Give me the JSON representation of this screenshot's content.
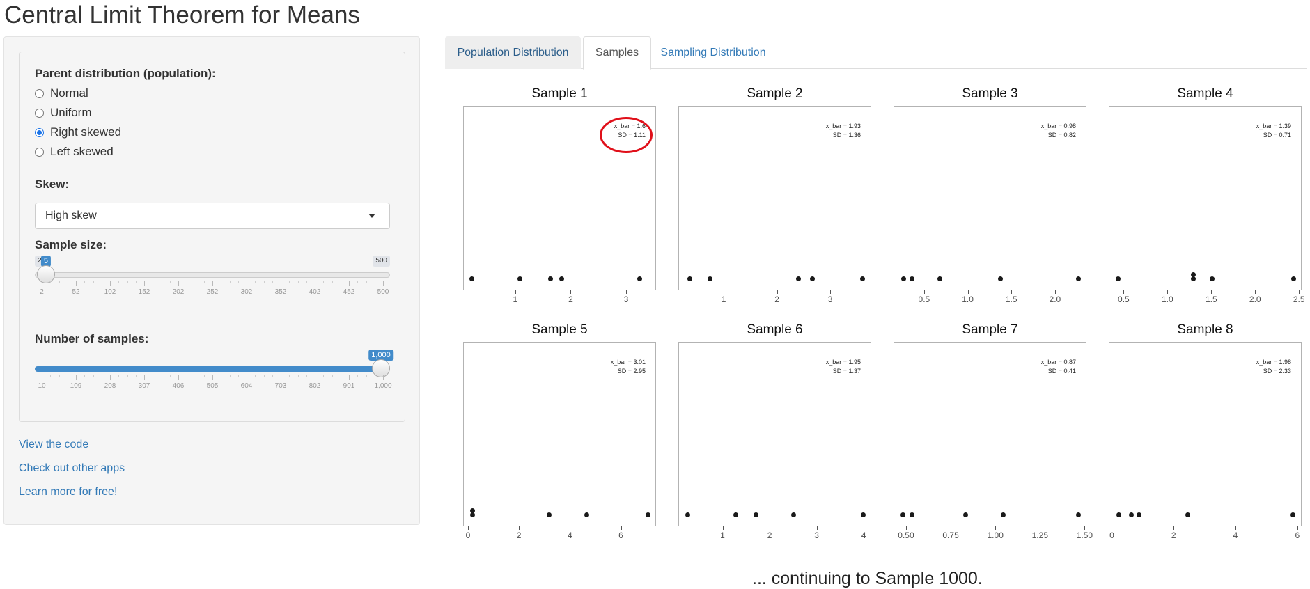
{
  "app": {
    "title": "Central Limit Theorem for Means"
  },
  "sidebar": {
    "parent_label": "Parent distribution (population):",
    "parent_options": [
      {
        "label": "Normal",
        "checked": false
      },
      {
        "label": "Uniform",
        "checked": false
      },
      {
        "label": "Right skewed",
        "checked": true
      },
      {
        "label": "Left skewed",
        "checked": false
      }
    ],
    "skew_label": "Skew:",
    "skew_value": "High skew",
    "sample_size": {
      "label": "Sample size:",
      "min": 2,
      "max": 500,
      "value": 5,
      "min_text": "2",
      "max_text": "500",
      "value_text": "5",
      "grid": [
        "2",
        "52",
        "102",
        "152",
        "202",
        "252",
        "302",
        "352",
        "402",
        "452",
        "500"
      ]
    },
    "num_samples": {
      "label": "Number of samples:",
      "min": 10,
      "max": 1000,
      "value": 1000,
      "min_text": "10",
      "max_text": "1,000",
      "value_text": "1,000",
      "grid": [
        "10",
        "109",
        "208",
        "307",
        "406",
        "505",
        "604",
        "703",
        "802",
        "901",
        "1,000"
      ]
    },
    "links": [
      "View the code",
      "Check out other apps",
      "Learn more for free!"
    ]
  },
  "tabs": [
    {
      "label": "Population Distribution",
      "state": "inactive-gray"
    },
    {
      "label": "Samples",
      "state": "active"
    },
    {
      "label": "Sampling Distribution",
      "state": "link"
    }
  ],
  "chart_data": [
    {
      "type": "scatter",
      "title": "Sample 1",
      "xbar": "x_bar = 1.6",
      "sd": "SD = 1.11",
      "x": [
        0.2,
        1.07,
        1.63,
        1.82,
        3.23
      ],
      "xlim": [
        0.06,
        3.54
      ],
      "xticks": [
        1,
        2,
        3
      ]
    },
    {
      "type": "scatter",
      "title": "Sample 2",
      "xbar": "x_bar = 1.93",
      "sd": "SD = 1.36",
      "x": [
        0.35,
        0.73,
        2.39,
        2.65,
        3.59
      ],
      "xlim": [
        0.15,
        3.77
      ],
      "xticks": [
        1,
        2,
        3
      ]
    },
    {
      "type": "scatter",
      "title": "Sample 3",
      "xbar": "x_bar = 0.98",
      "sd": "SD = 0.82",
      "x": [
        0.26,
        0.35,
        0.67,
        1.37,
        2.26
      ],
      "xlim": [
        0.15,
        2.36
      ],
      "xticks": [
        0.5,
        1.0,
        1.5,
        2.0
      ],
      "xtick_labels": [
        "0.5",
        "1.0",
        "1.5",
        "2.0"
      ]
    },
    {
      "type": "scatter",
      "title": "Sample 4",
      "xbar": "x_bar = 1.39",
      "sd": "SD = 0.71",
      "x": [
        0.43,
        1.29,
        1.29,
        1.5,
        2.43
      ],
      "xlim": [
        0.33,
        2.53
      ],
      "xticks": [
        0.5,
        1.0,
        1.5,
        2.0,
        2.5
      ],
      "xtick_labels": [
        "0.5",
        "1.0",
        "1.5",
        "2.0",
        "2.5"
      ]
    },
    {
      "type": "scatter",
      "title": "Sample 5",
      "xbar": "x_bar = 3.01",
      "sd": "SD = 2.95",
      "x": [
        0.16,
        0.16,
        3.15,
        4.62,
        7.03
      ],
      "xlim": [
        -0.19,
        7.38
      ],
      "xticks": [
        0,
        2,
        4,
        6
      ]
    },
    {
      "type": "scatter",
      "title": "Sample 6",
      "xbar": "x_bar = 1.95",
      "sd": "SD = 1.37",
      "x": [
        0.25,
        1.27,
        1.7,
        2.5,
        3.97
      ],
      "xlim": [
        0.06,
        4.16
      ],
      "xticks": [
        1,
        2,
        3,
        4
      ]
    },
    {
      "type": "scatter",
      "title": "Sample 7",
      "xbar": "x_bar = 0.87",
      "sd": "SD = 0.41",
      "x": [
        0.48,
        0.53,
        0.83,
        1.04,
        1.46
      ],
      "xlim": [
        0.43,
        1.51
      ],
      "xticks": [
        0.5,
        0.75,
        1.0,
        1.25,
        1.5
      ],
      "xtick_labels": [
        "0.50",
        "0.75",
        "1.00",
        "1.25",
        "1.50"
      ]
    },
    {
      "type": "scatter",
      "title": "Sample 8",
      "xbar": "x_bar = 1.98",
      "sd": "SD = 2.33",
      "x": [
        0.2,
        0.6,
        0.85,
        2.43,
        5.84
      ],
      "xlim": [
        -0.1,
        6.14
      ],
      "xticks": [
        0,
        2,
        4,
        6
      ]
    }
  ],
  "footer": {
    "note": "... continuing to Sample 1000."
  },
  "colors": {
    "accent": "#428bca",
    "link": "#337ab7",
    "annotation": "#e0101a"
  }
}
